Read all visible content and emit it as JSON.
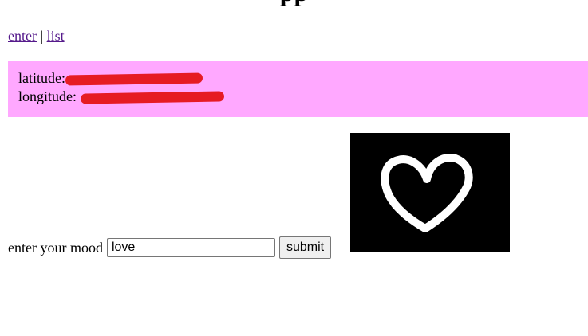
{
  "header": {
    "title_partial": "pp"
  },
  "nav": {
    "enter_label": "enter",
    "separator": "|",
    "list_label": "list"
  },
  "location": {
    "latitude_label": "latitude:",
    "longitude_label": "longitude:",
    "redaction_color": "#e61b23",
    "panel_color": "#ffa8ff"
  },
  "mood_form": {
    "label": "enter your mood",
    "input_value": "love",
    "submit_label": "submit"
  },
  "capture": {
    "icon": "heart-drawing"
  }
}
